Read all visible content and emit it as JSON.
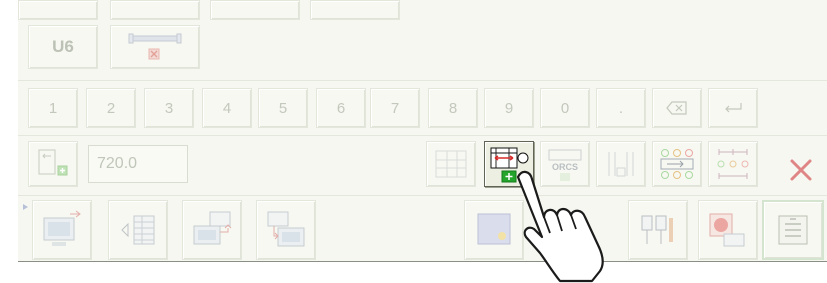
{
  "component_tab": {
    "label": "U6"
  },
  "keypad": {
    "keys": [
      "1",
      "2",
      "3",
      "4",
      "5",
      "6",
      "7",
      "8",
      "9",
      "0",
      "."
    ],
    "backspace_icon": "backspace-icon",
    "enter_icon": "enter-arrow-icon"
  },
  "dimension": {
    "value": "720.0"
  },
  "colors": {
    "accent_green": "#22a52a",
    "close_red": "#d94a4a",
    "panel_bg": "#f6f7f0"
  },
  "icons": {
    "dimension_tool": "dimension-tool-icon",
    "orcs_label": "ORCS",
    "pointer": "hand-pointer-icon"
  }
}
